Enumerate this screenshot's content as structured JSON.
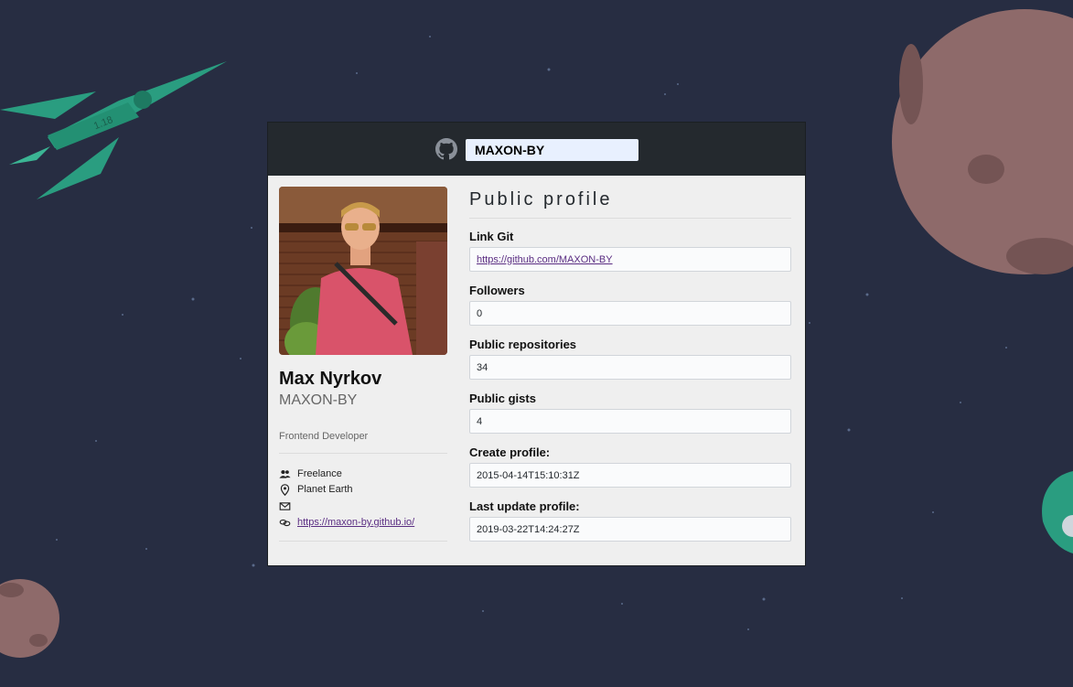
{
  "header": {
    "logo_icon": "github-mark-icon",
    "search_value": "MAXON-BY"
  },
  "profile": {
    "avatar_icon": "avatar-photo",
    "name": "Max Nyrkov",
    "login": "MAXON-BY",
    "bio": "Frontend Developer",
    "details": {
      "company": {
        "icon": "people-icon",
        "text": "Freelance"
      },
      "location": {
        "icon": "location-pin-icon",
        "text": "Planet Earth"
      },
      "email": {
        "icon": "mail-icon",
        "text": ""
      },
      "blog": {
        "icon": "link-icon",
        "text": "https://maxon-by.github.io/"
      }
    }
  },
  "public_profile": {
    "title": "Public profile",
    "fields": [
      {
        "label": "Link Git",
        "value": "https://github.com/MAXON-BY"
      },
      {
        "label": "Followers",
        "value": "0"
      },
      {
        "label": "Public repositories",
        "value": "34"
      },
      {
        "label": "Public gists",
        "value": "4"
      },
      {
        "label": "Create profile:",
        "value": "2015-04-14T15:10:31Z"
      },
      {
        "label": "Last update profile:",
        "value": "2019-03-22T14:24:27Z"
      }
    ]
  },
  "background": {
    "rocket_label": "1.18",
    "colors": {
      "space": "#272d42",
      "rocket": "#2a9d80",
      "planet": "#8e6a6a",
      "header": "#24292e",
      "card": "#efefef"
    }
  }
}
